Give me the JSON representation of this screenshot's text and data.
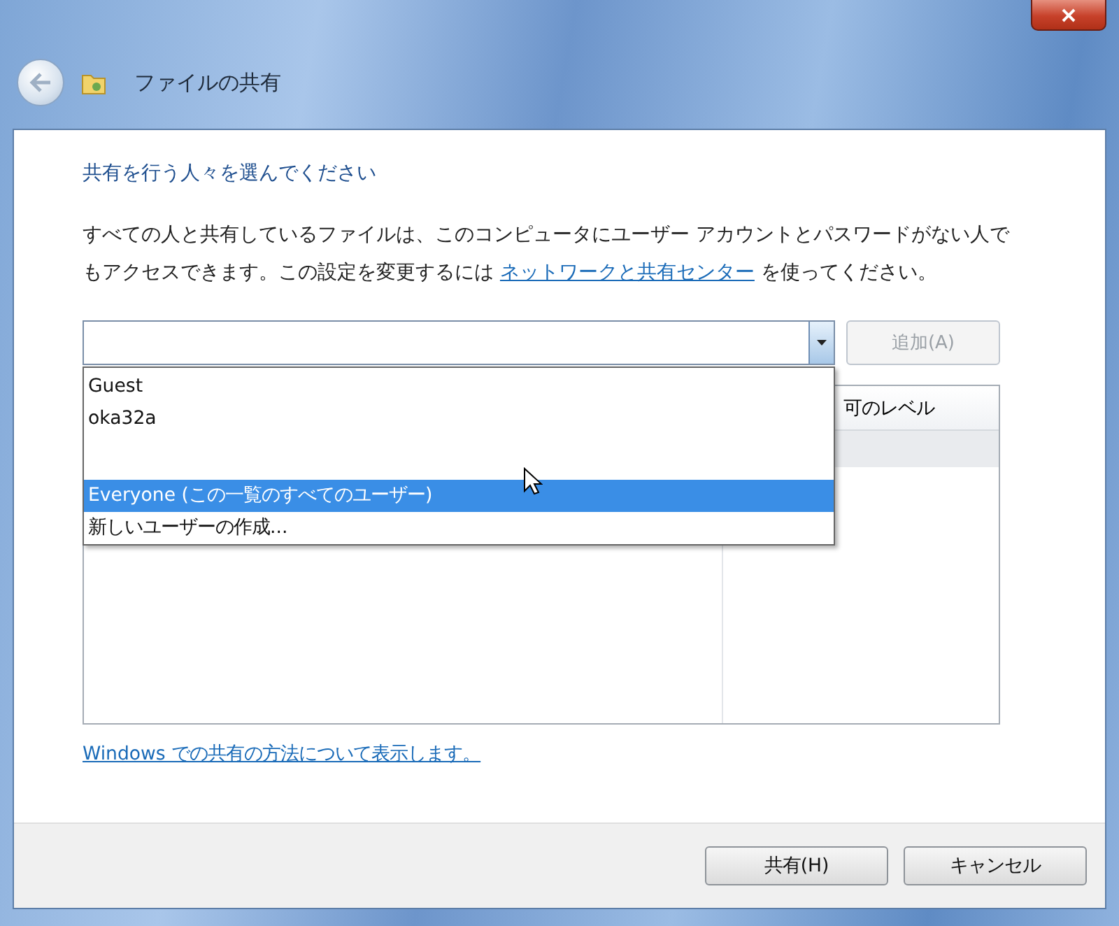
{
  "window": {
    "title": "ファイルの共有"
  },
  "heading": "共有を行う人々を選んでください",
  "description": {
    "text": "すべての人と共有しているファイルは、このコンピュータにユーザー アカウントとパスワードがない人でもアクセスできます。この設定を変更するには",
    "link": "ネットワークと共有センター",
    "tail": "を使ってください。"
  },
  "user_combo": {
    "expanded": true,
    "options": [
      {
        "kind": "user",
        "label": "Guest",
        "selected": false
      },
      {
        "kind": "user",
        "label": "oka32a",
        "selected": false
      },
      {
        "kind": "blank",
        "selected": false
      },
      {
        "kind": "user",
        "label": "Everyone (この一覧のすべてのユーザー)",
        "selected": true
      },
      {
        "kind": "user",
        "label": "新しいユーザーの作成...",
        "selected": false
      }
    ]
  },
  "add_button": {
    "label": "追加(A)",
    "disabled": true
  },
  "table": {
    "columns": [
      "可のレベル"
    ]
  },
  "help_link": "Windows での共有の方法について表示します。",
  "buttons": [
    {
      "label": "共有(H)"
    },
    {
      "label": "キャンセル"
    }
  ]
}
